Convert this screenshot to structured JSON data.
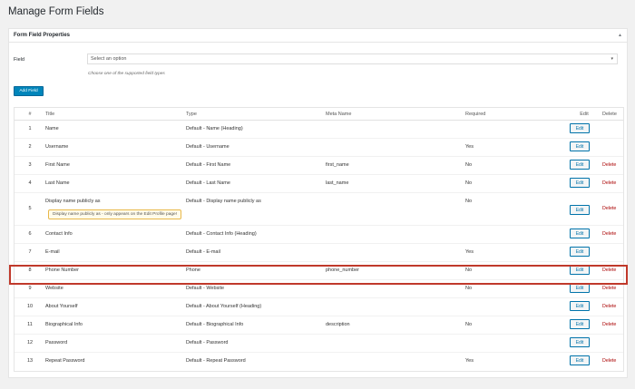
{
  "page": {
    "title": "Manage Form Fields"
  },
  "panel": {
    "title": "Form Field Properties",
    "toggle_icon": "triangle-up"
  },
  "field_select": {
    "label": "Field",
    "selected": "Select an option",
    "hint": "Choose one of the supported field types"
  },
  "add_button": {
    "label": "Add Field"
  },
  "table": {
    "headers": {
      "num": "#",
      "title": "Title",
      "type": "Type",
      "meta": "Meta Name",
      "required": "Required",
      "edit": "Edit",
      "delete": "Delete"
    },
    "rows": [
      {
        "num": "1",
        "title": "Name",
        "type": "Default - Name (Heading)",
        "meta": "",
        "required": "",
        "edit": "Edit",
        "delete": ""
      },
      {
        "num": "2",
        "title": "Username",
        "type": "Default - Username",
        "meta": "",
        "required": "Yes",
        "edit": "Edit",
        "delete": ""
      },
      {
        "num": "3",
        "title": "First Name",
        "type": "Default - First Name",
        "meta": "first_name",
        "required": "No",
        "edit": "Edit",
        "delete": "Delete"
      },
      {
        "num": "4",
        "title": "Last Name",
        "type": "Default - Last Name",
        "meta": "last_name",
        "required": "No",
        "edit": "Edit",
        "delete": "Delete"
      },
      {
        "num": "5",
        "title": "Display name publicly as",
        "type": "Default - Display name publicly as",
        "meta": "",
        "required": "No",
        "edit": "Edit",
        "delete": "Delete",
        "tooltip": "Display name publicly as - only appears on the Edit Profile page!"
      },
      {
        "num": "6",
        "title": "Contact Info",
        "type": "Default - Contact Info (Heading)",
        "meta": "",
        "required": "",
        "edit": "Edit",
        "delete": "Delete"
      },
      {
        "num": "7",
        "title": "E-mail",
        "type": "Default - E-mail",
        "meta": "",
        "required": "Yes",
        "edit": "Edit",
        "delete": ""
      },
      {
        "num": "8",
        "title": "Phone Number",
        "type": "Phone",
        "meta": "phone_number",
        "required": "No",
        "edit": "Edit",
        "delete": "Delete"
      },
      {
        "num": "9",
        "title": "Website",
        "type": "Default - Website",
        "meta": "",
        "required": "No",
        "edit": "Edit",
        "delete": "Delete"
      },
      {
        "num": "10",
        "title": "About Yourself",
        "type": "Default - About Yourself (Heading)",
        "meta": "",
        "required": "",
        "edit": "Edit",
        "delete": "Delete"
      },
      {
        "num": "11",
        "title": "Biographical Info",
        "type": "Default - Biographical Info",
        "meta": "description",
        "required": "No",
        "edit": "Edit",
        "delete": "Delete"
      },
      {
        "num": "12",
        "title": "Password",
        "type": "Default - Password",
        "meta": "",
        "required": "",
        "edit": "Edit",
        "delete": ""
      },
      {
        "num": "13",
        "title": "Repeat Password",
        "type": "Default - Repeat Password",
        "meta": "",
        "required": "Yes",
        "edit": "Edit",
        "delete": "Delete"
      }
    ]
  },
  "colors": {
    "accent": "#0085ba",
    "delete": "#aa0000",
    "highlight": "#c0392b"
  }
}
